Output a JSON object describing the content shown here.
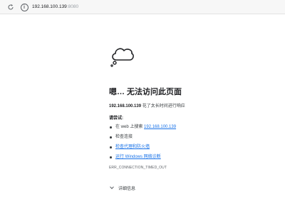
{
  "browser": {
    "refresh_icon": "refresh-icon",
    "info_icon": "info-icon",
    "address_host": "192.168.100.139",
    "address_port": ":8080"
  },
  "error_page": {
    "icon": "cloud-thought-icon",
    "heading": "嗯… 无法访问此页面",
    "host": "192.168.100.139",
    "message": " 花了太长时间进行响应",
    "try_label": "请尝试:",
    "suggestions": [
      {
        "prefix": "在 web 上搜索 ",
        "link": "192.168.100.139"
      },
      {
        "prefix": "检查连接",
        "link": ""
      },
      {
        "prefix": "",
        "link": "检查代理和防火墙"
      },
      {
        "prefix": "",
        "link": "运行 Windows 网络诊断"
      }
    ],
    "error_code": "ERR_CONNECTION_TIMED_OUT",
    "details_label": "详细信息"
  },
  "colors": {
    "link": "#1a73e8",
    "text": "#202124",
    "muted": "#5f6368"
  }
}
